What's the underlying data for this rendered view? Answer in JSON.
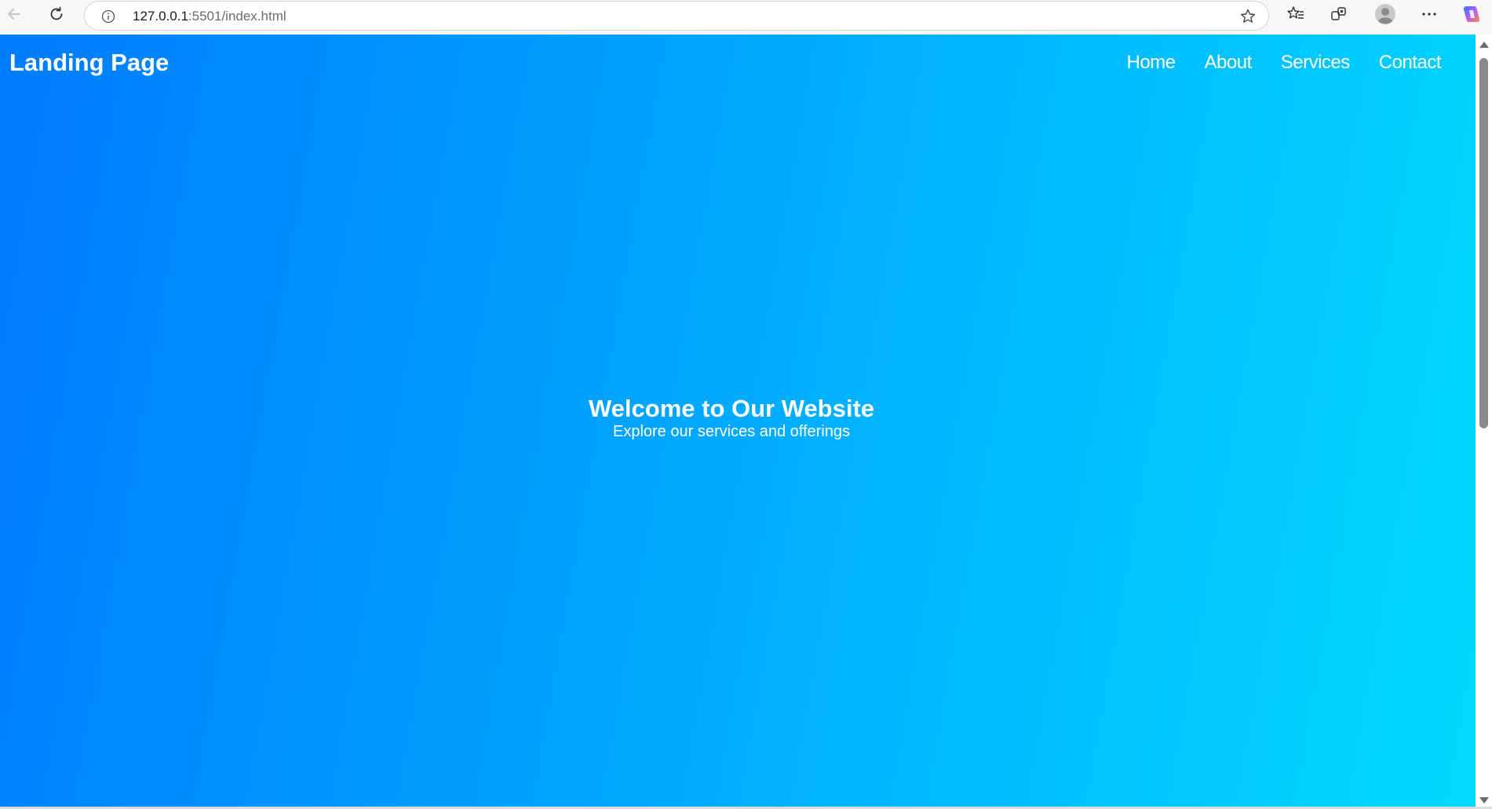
{
  "browser": {
    "url_host": "127.0.0.1",
    "url_rest": ":5501/index.html",
    "icons": {
      "back": "back-arrow-icon",
      "refresh": "refresh-icon",
      "site_info": "info-icon",
      "favorite": "star-icon",
      "favorites": "favorites-icon",
      "collections": "collections-icon",
      "profile": "profile-icon",
      "more": "more-icon",
      "copilot": "copilot-icon"
    }
  },
  "page": {
    "brand": "Landing Page",
    "nav": {
      "home": "Home",
      "about": "About",
      "services": "Services",
      "contact": "Contact"
    },
    "hero": {
      "title": "Welcome to Our Website",
      "subtitle": "Explore our services and offerings"
    },
    "colors": {
      "gradient_start": "#007bff",
      "gradient_end": "#00d9ff",
      "text": "#ffffff"
    }
  }
}
